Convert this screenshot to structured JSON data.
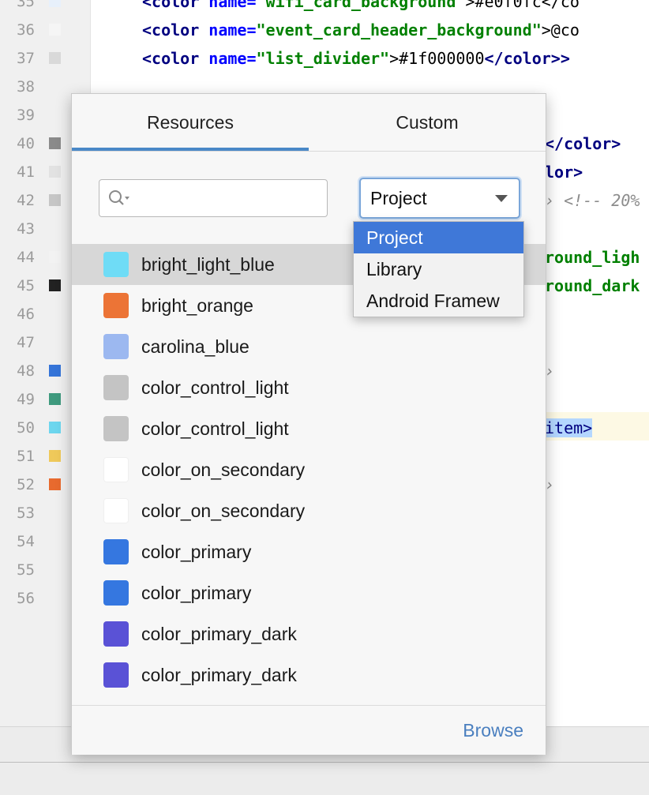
{
  "editor": {
    "line_numbers": [
      "35",
      "36",
      "37",
      "38",
      "39",
      "40",
      "41",
      "42",
      "43",
      "44",
      "45",
      "46",
      "47",
      "48",
      "49",
      "50",
      "51",
      "52",
      "53",
      "54",
      "55",
      "56"
    ],
    "gutter_swatches": [
      "#e7f0fb",
      "#f5f5f5",
      "#d9d9d9",
      "#8a8a8a",
      "#e2e2e2",
      "#c6c6c6",
      "#f2f2f2",
      "#222222",
      "#3574d8",
      "#3f9a7e",
      "#6dd6ee",
      "#efc95a",
      "#e86a2e"
    ],
    "code_lines": [
      {
        "tag_open": "<color",
        "attr": " name=",
        "value": "\"wifi_card_background\"",
        "rest": ">#e0f0fc</co"
      },
      {
        "tag_open": "<color",
        "attr": " name=",
        "value": "\"event_card_header_background\"",
        "rest": ">@co"
      },
      {
        "tag_open": "<color",
        "attr": " name=",
        "value": "\"list_divider\"",
        "rest": ">#1f000000",
        "tag_close": "</color>>"
      }
    ],
    "right_fragments": {
      "l40": "</color>",
      "l41": "lor>",
      "l42_arrow": "›",
      "l42_comment": "<!-- 20%",
      "l44": "round_ligh",
      "l45": "round_dark",
      "l48": "›",
      "l50": "item>",
      "l52": "›"
    }
  },
  "picker": {
    "tabs": {
      "resources": "Resources",
      "custom": "Custom"
    },
    "search": {
      "placeholder": ""
    },
    "scope": {
      "selected": "Project",
      "options": [
        "Project",
        "Library",
        "Android Framew"
      ]
    },
    "resources": [
      {
        "name": "bright_light_blue",
        "color": "#6fdcf6",
        "selected": true
      },
      {
        "name": "bright_orange",
        "color": "#ec7436"
      },
      {
        "name": "carolina_blue",
        "color": "#9cb8f0"
      },
      {
        "name": "color_control_light",
        "color": "#c4c4c4"
      },
      {
        "name": "color_control_light",
        "color": "#c4c4c4"
      },
      {
        "name": "color_on_secondary",
        "color": "#ffffff"
      },
      {
        "name": "color_on_secondary",
        "color": "#ffffff"
      },
      {
        "name": "color_primary",
        "color": "#3577e0"
      },
      {
        "name": "color_primary",
        "color": "#3577e0"
      },
      {
        "name": "color_primary_dark",
        "color": "#5a52d6"
      },
      {
        "name": "color_primary_dark",
        "color": "#5a52d6"
      }
    ],
    "footer": {
      "browse": "Browse"
    }
  }
}
